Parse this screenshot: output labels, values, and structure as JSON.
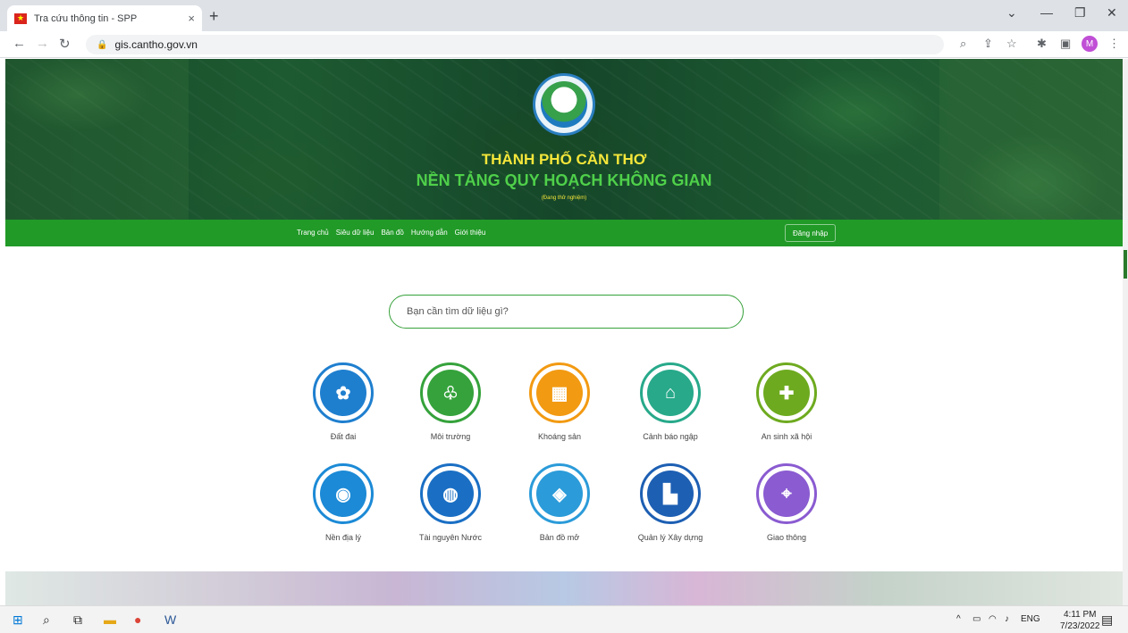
{
  "browser": {
    "tab_title": "Tra cứu thông tin - SPP",
    "tab_close": "×",
    "new_tab": "+",
    "url": "gis.cantho.gov.vn",
    "profile_initial": "M",
    "window_controls": [
      "chevron-down-icon",
      "minimize-icon",
      "restore-icon",
      "close-icon"
    ]
  },
  "hero": {
    "city": "THÀNH PHỐ CẦN THƠ",
    "platform": "NỀN TẢNG QUY HOẠCH KHÔNG GIAN",
    "status": "(Đang thử nghiệm)"
  },
  "nav": {
    "items": [
      "Trang chủ",
      "Siêu dữ liệu",
      "Bản đồ",
      "Hướng dẫn",
      "Giới thiệu"
    ],
    "login": "Đăng nhập"
  },
  "search": {
    "placeholder": "Bạn cần tìm dữ liệu gì?"
  },
  "categories": [
    {
      "label": "Đất đai",
      "color": "#1f7fcf",
      "icon": "land-icon"
    },
    {
      "label": "Môi trường",
      "color": "#35a23b",
      "icon": "environment-icon"
    },
    {
      "label": "Khoáng sản",
      "color": "#f29a12",
      "icon": "minerals-icon"
    },
    {
      "label": "Cảnh báo ngập",
      "color": "#27a98a",
      "icon": "flood-warning-icon"
    },
    {
      "label": "An sinh xã hội",
      "color": "#6eaa1f",
      "icon": "social-welfare-icon"
    },
    {
      "label": "Nền địa lý",
      "color": "#1c8ad6",
      "icon": "geography-icon"
    },
    {
      "label": "Tài nguyên Nước",
      "color": "#1a6fc4",
      "icon": "water-resources-icon"
    },
    {
      "label": "Bản đồ mở",
      "color": "#2b9bd9",
      "icon": "open-map-icon"
    },
    {
      "label": "Quản lý Xây dựng",
      "color": "#1d5fb3",
      "icon": "construction-icon"
    },
    {
      "label": "Giao thông",
      "color": "#8a5bd1",
      "icon": "transport-icon"
    }
  ],
  "taskbar": {
    "lang": "ENG",
    "time": "4:11 PM",
    "date": "7/23/2022"
  }
}
